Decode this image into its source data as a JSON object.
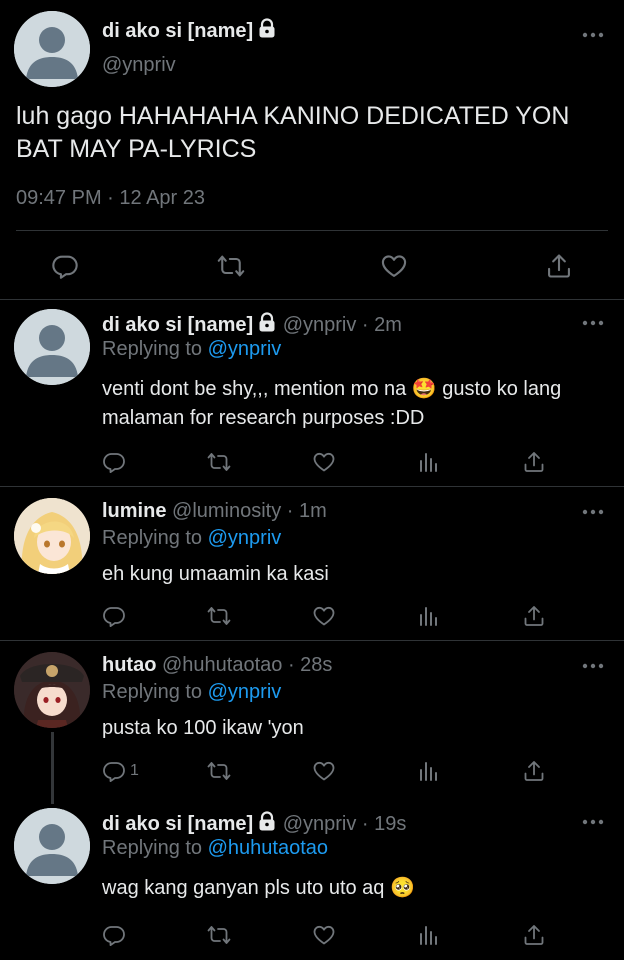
{
  "main_tweet": {
    "display_name": "di ako si [name]",
    "handle": "@ynpriv",
    "text": "luh gago HAHAHAHA KANINO DEDICATED YON BAT MAY PA-LYRICS",
    "timestamp": "09:47 PM · 12 Apr 23",
    "actions": {
      "reply_icon": "reply-icon",
      "retweet_icon": "retweet-icon",
      "like_icon": "like-icon",
      "share_icon": "share-icon"
    }
  },
  "replies": [
    {
      "display_name": "di ako si [name]",
      "handle": "@ynpriv · 2m",
      "replying_prefix": "Replying to",
      "replying_to": "@ynpriv",
      "text": "venti dont be shy,,, mention mo na 🤩  gusto ko lang malaman for research purposes :DD",
      "reply_count": ""
    },
    {
      "display_name": "lumine",
      "handle": "@luminosity · 1m",
      "replying_prefix": "Replying to",
      "replying_to": "@ynpriv",
      "text": "eh kung umaamin ka kasi",
      "reply_count": ""
    },
    {
      "display_name": "hutao",
      "handle": "@huhutaotao · 28s",
      "replying_prefix": "Replying to",
      "replying_to": "@ynpriv",
      "text": "pusta ko 100 ikaw 'yon",
      "reply_count": "1"
    },
    {
      "display_name": "di ako si [name]",
      "handle": "@ynpriv · 19s",
      "replying_prefix": "Replying to",
      "replying_to": "@huhutaotao",
      "text": "wag kang ganyan pls uto uto aq 🥺",
      "reply_count": ""
    }
  ],
  "colors": {
    "background": "#000000",
    "text": "#e7e9ea",
    "muted": "#71767b",
    "link": "#1d9bf0",
    "divider": "#2f3336"
  }
}
